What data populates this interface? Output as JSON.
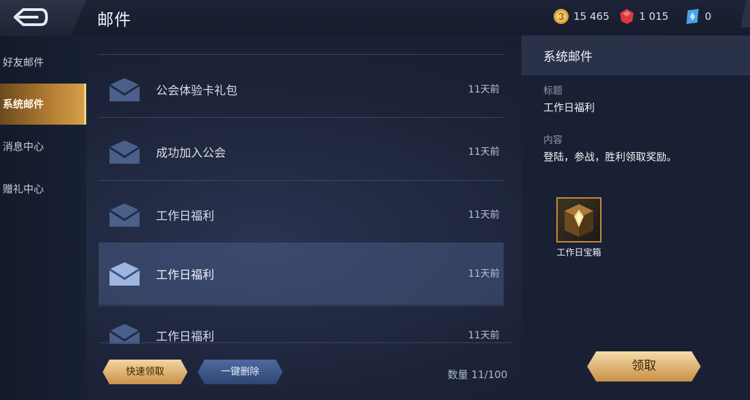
{
  "header": {
    "title": "邮件",
    "currencies": [
      {
        "name": "gold-coin-icon",
        "value": "15 465",
        "color": "#e0a43a"
      },
      {
        "name": "ruby-icon",
        "value": "1 015",
        "color": "#d93b3b"
      },
      {
        "name": "diamond-icon",
        "value": "0",
        "color": "#4aa3e6"
      }
    ]
  },
  "sidebar": {
    "items": [
      {
        "label": "好友邮件"
      },
      {
        "label": "系统邮件",
        "active": true
      },
      {
        "label": "消息中心"
      },
      {
        "label": "赠礼中心"
      }
    ]
  },
  "mail_list": {
    "rows": [
      {
        "subject": "公会体验卡礼包",
        "time": "11天前"
      },
      {
        "subject": "成功加入公会",
        "time": "11天前"
      },
      {
        "subject": "工作日福利",
        "time": "11天前"
      },
      {
        "subject": "工作日福利",
        "time": "11天前",
        "selected": true
      },
      {
        "subject": "工作日福利",
        "time": "11天前"
      }
    ]
  },
  "actions": {
    "quick_claim": "快速领取",
    "delete_all": "一键删除",
    "count_label": "数量",
    "count_value": "11/100"
  },
  "detail": {
    "header": "系统邮件",
    "title_label": "标题",
    "title_value": "工作日福利",
    "content_label": "内容",
    "content_value": "登陆，参战，胜利领取奖励。",
    "reward_name": "工作日宝箱",
    "claim_button": "领取"
  },
  "colors": {
    "accent_gold": "#d6a24a",
    "selected_row": "#5a6ea0",
    "background": "#1c2338"
  }
}
